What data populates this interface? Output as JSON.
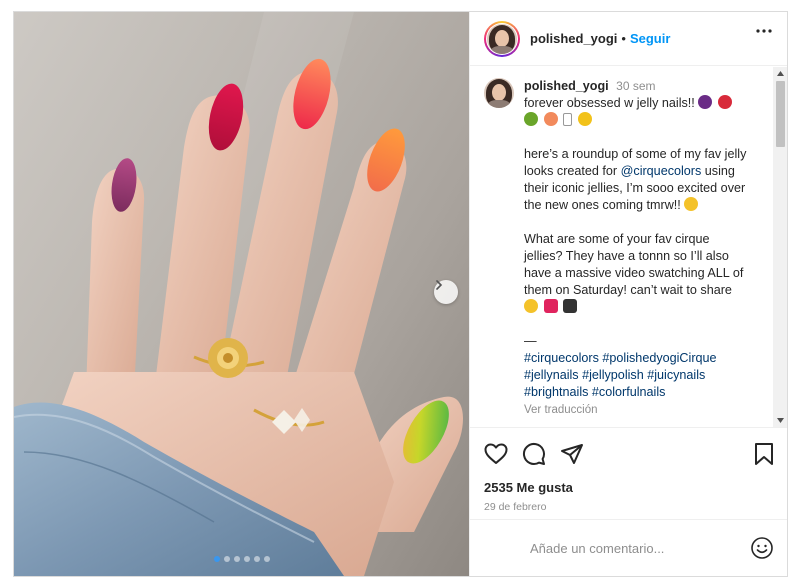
{
  "post": {
    "username": "polished_yogi",
    "separator": "•",
    "follow_label": "Seguir",
    "more_icon": "more-horizontal-icon"
  },
  "caption": {
    "username": "polished_yogi",
    "time": "30 sem",
    "line1": "forever obsessed w jelly nails!!",
    "para2_prefix": "here’s a roundup of some of my fav jelly looks created for ",
    "mention": "@cirquecolors",
    "para2_suffix": " using their iconic jellies, I’m sooo excited over the new ones coming tmrw!!",
    "para3": "What are some of your fav cirque jellies? They have a tonnn so I’ll also have a massive video swatching ALL of them on Saturday! can’t wait to share",
    "divider": "—",
    "hashtags": [
      "#cirquecolors",
      "#polishedyogiCirque",
      "#jellynails",
      "#jellypolish",
      "#juicynails",
      "#brightnails",
      "#colorfulnails"
    ],
    "translate": "Ver traducción"
  },
  "engagement": {
    "likes": "2535 Me gusta",
    "date": "29 de febrero"
  },
  "comment": {
    "placeholder": "Añade un comentario..."
  },
  "carousel": {
    "slide_count": 6,
    "active_index": 0
  },
  "colors": {
    "follow_blue": "#0095f6",
    "link_blue": "#00376b",
    "muted": "#8e8e8e",
    "text": "#262626"
  }
}
